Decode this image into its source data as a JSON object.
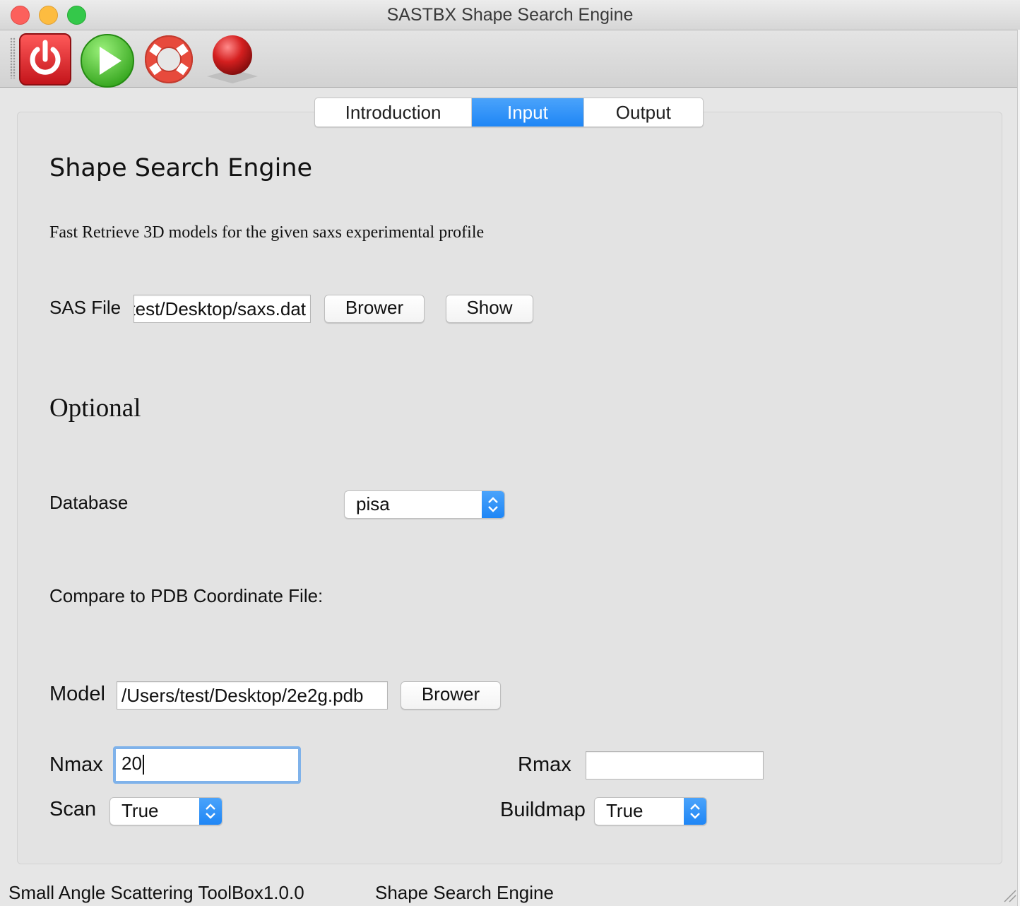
{
  "window": {
    "title": "SASTBX Shape Search Engine"
  },
  "toolbar": {
    "icons": [
      "power-icon",
      "play-icon",
      "lifebuoy-help-icon",
      "red-sphere-icon"
    ]
  },
  "tabs": [
    {
      "label": "Introduction",
      "active": false
    },
    {
      "label": "Input",
      "active": true
    },
    {
      "label": "Output",
      "active": false
    }
  ],
  "main": {
    "title": "Shape Search Engine",
    "description": "Fast Retrieve 3D models for the given saxs experimental profile",
    "sas_file": {
      "label": "SAS File",
      "value": "/Users/test/Desktop/saxs.dat",
      "browse_label": "Brower",
      "show_label": "Show"
    },
    "optional_title": "Optional",
    "database": {
      "label": "Database",
      "selected": "pisa"
    },
    "compare_label": "Compare to PDB Coordinate File:",
    "model": {
      "label": "Model",
      "value": "/Users/test/Desktop/2e2g.pdb",
      "browse_label": "Brower"
    },
    "nmax": {
      "label": "Nmax",
      "value": "20"
    },
    "rmax": {
      "label": "Rmax",
      "value": ""
    },
    "scan": {
      "label": "Scan",
      "selected": "True"
    },
    "buildmap": {
      "label": "Buildmap",
      "selected": "True"
    }
  },
  "status": {
    "left": "Small Angle Scattering ToolBox1.0.0",
    "right": "Shape Search Engine"
  },
  "colors": {
    "accent": "#1f86f5",
    "power_red": "#e0262b",
    "play_green": "#3fbf23",
    "focus_ring": "#7fb2ea"
  }
}
